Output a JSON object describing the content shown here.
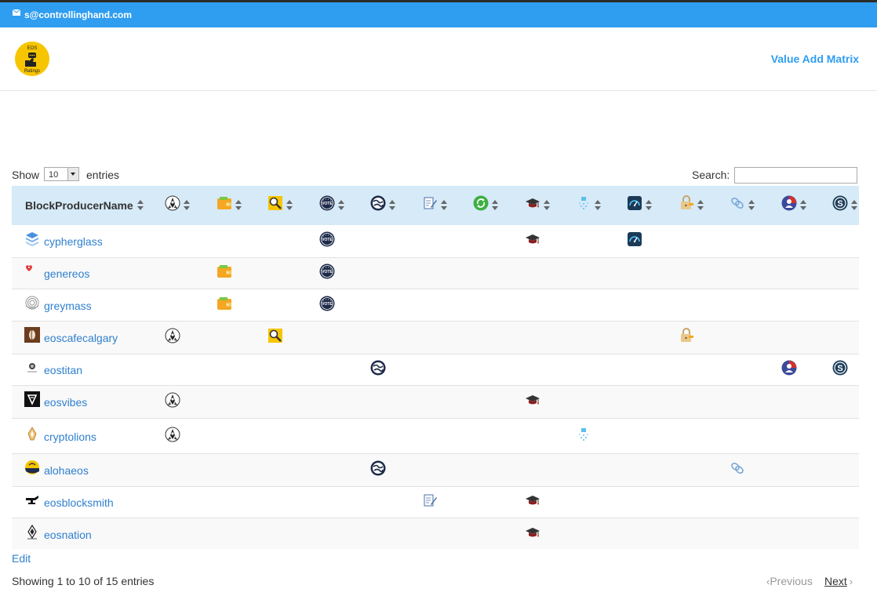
{
  "topbar": {
    "email": "s@controllinghand.com",
    "icon": "envelope-icon"
  },
  "header": {
    "logo_text_top": "EOS",
    "logo_text_bottom": "Ratings",
    "nav_link": "Value Add Matrix"
  },
  "table_controls": {
    "show_label": "Show",
    "page_length": "10",
    "entries_label": "entries",
    "search_label": "Search:",
    "search_value": ""
  },
  "columns": [
    {
      "label": "BlockProducerName"
    },
    {
      "icon": "rocket-icon"
    },
    {
      "icon": "wallet-icon"
    },
    {
      "icon": "explorer-search-icon"
    },
    {
      "icon": "vote-badge-icon"
    },
    {
      "icon": "globe-icon"
    },
    {
      "icon": "document-sign-icon"
    },
    {
      "icon": "refresh-icon"
    },
    {
      "icon": "graduation-cap-icon"
    },
    {
      "icon": "faucet-icon"
    },
    {
      "icon": "speedometer-icon"
    },
    {
      "icon": "lock-key-icon"
    },
    {
      "icon": "link-chain-icon"
    },
    {
      "icon": "user-badge-icon"
    },
    {
      "icon": "coin-icon"
    }
  ],
  "rows": [
    {
      "name": "cypherglass",
      "logo": "cypherglass-logo",
      "icons": [
        4,
        8,
        10
      ]
    },
    {
      "name": "genereos",
      "logo": "genereos-logo",
      "icons": [
        2,
        4
      ]
    },
    {
      "name": "greymass",
      "logo": "greymass-logo",
      "icons": [
        2,
        4
      ]
    },
    {
      "name": "eoscafecalgary",
      "logo": "eoscafecalgary-logo",
      "icons": [
        1,
        3,
        11
      ]
    },
    {
      "name": "eostitan",
      "logo": "eostitan-logo",
      "icons": [
        5,
        13,
        14
      ]
    },
    {
      "name": "eosvibes",
      "logo": "eosvibes-logo",
      "icons": [
        1,
        8
      ]
    },
    {
      "name": "cryptolions",
      "logo": "cryptolions-logo",
      "icons": [
        1,
        9
      ]
    },
    {
      "name": "alohaeos",
      "logo": "alohaeos-logo",
      "icons": [
        5,
        12
      ]
    },
    {
      "name": "eosblocksmith",
      "logo": "eosblocksmith-logo",
      "icons": [
        6,
        8
      ]
    },
    {
      "name": "eosnation",
      "logo": "eosnation-logo",
      "icons": [
        8
      ]
    }
  ],
  "footer": {
    "edit_label": "Edit",
    "info": "Showing 1 to 10 of 15 entries",
    "previous_label": "Previous",
    "next_label": "Next"
  },
  "colors": {
    "topbar": "#2f9df0",
    "link": "#2f80d0",
    "header_row": "#d6eaf8"
  }
}
